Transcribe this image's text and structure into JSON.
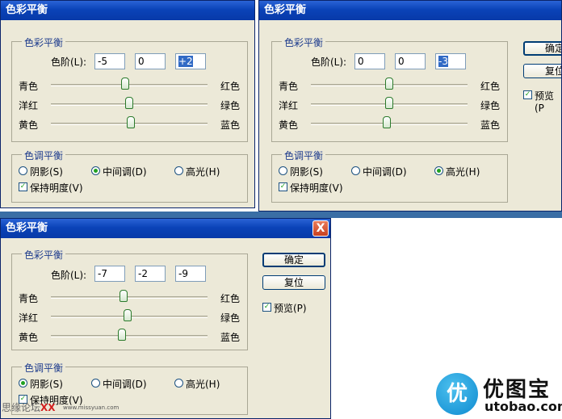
{
  "dialog1": {
    "title": "色彩平衡",
    "color_group": "色彩平衡",
    "level_label": "色阶(L):",
    "levels": [
      "-5",
      "0",
      "+2"
    ],
    "sliders": [
      {
        "left": "青色",
        "right": "红色",
        "value": -5
      },
      {
        "left": "洋红",
        "right": "绿色",
        "value": 0
      },
      {
        "left": "黄色",
        "right": "蓝色",
        "value": 2
      }
    ],
    "tone_group": "色调平衡",
    "tones": [
      "阴影(S)",
      "中间调(D)",
      "高光(H)"
    ],
    "selected_tone": "中间调(D)",
    "preserve": "保持明度(V)"
  },
  "dialog2": {
    "title": "色彩平衡",
    "color_group": "色彩平衡",
    "level_label": "色阶(L):",
    "levels": [
      "0",
      "0",
      "-3"
    ],
    "sliders": [
      {
        "left": "青色",
        "right": "红色",
        "value": 0
      },
      {
        "left": "洋红",
        "right": "绿色",
        "value": 0
      },
      {
        "left": "黄色",
        "right": "蓝色",
        "value": -3
      }
    ],
    "tone_group": "色调平衡",
    "tones": [
      "阴影(S)",
      "中间调(D)",
      "高光(H)"
    ],
    "selected_tone": "高光(H)",
    "preserve": "保持明度(V)",
    "ok": "确定",
    "reset": "复位",
    "preview": "预览(P"
  },
  "dialog3": {
    "title": "色彩平衡",
    "close": "X",
    "color_group": "色彩平衡",
    "level_label": "色阶(L):",
    "levels": [
      "-7",
      "-2",
      "-9"
    ],
    "sliders": [
      {
        "left": "青色",
        "right": "红色",
        "value": -7
      },
      {
        "left": "洋红",
        "right": "绿色",
        "value": -2
      },
      {
        "left": "黄色",
        "right": "蓝色",
        "value": -9
      }
    ],
    "tone_group": "色调平衡",
    "tones": [
      "阴影(S)",
      "中间调(D)",
      "高光(H)"
    ],
    "selected_tone": "阴影(S)",
    "preserve": "保持明度(V)",
    "ok": "确定",
    "reset": "复位",
    "preview": "预览(P)"
  },
  "watermark": {
    "left_text": "思缘论坛",
    "left_mark": "XX",
    "url": "www.missyuan.com",
    "logo_char": "优",
    "brand": "优图宝",
    "brand_sub": "utobao.com"
  },
  "colors": {
    "title_blue": "#0a43b8",
    "dialog_bg": "#ece9d8",
    "selection": "#316ac5",
    "check_green": "#21a121"
  }
}
